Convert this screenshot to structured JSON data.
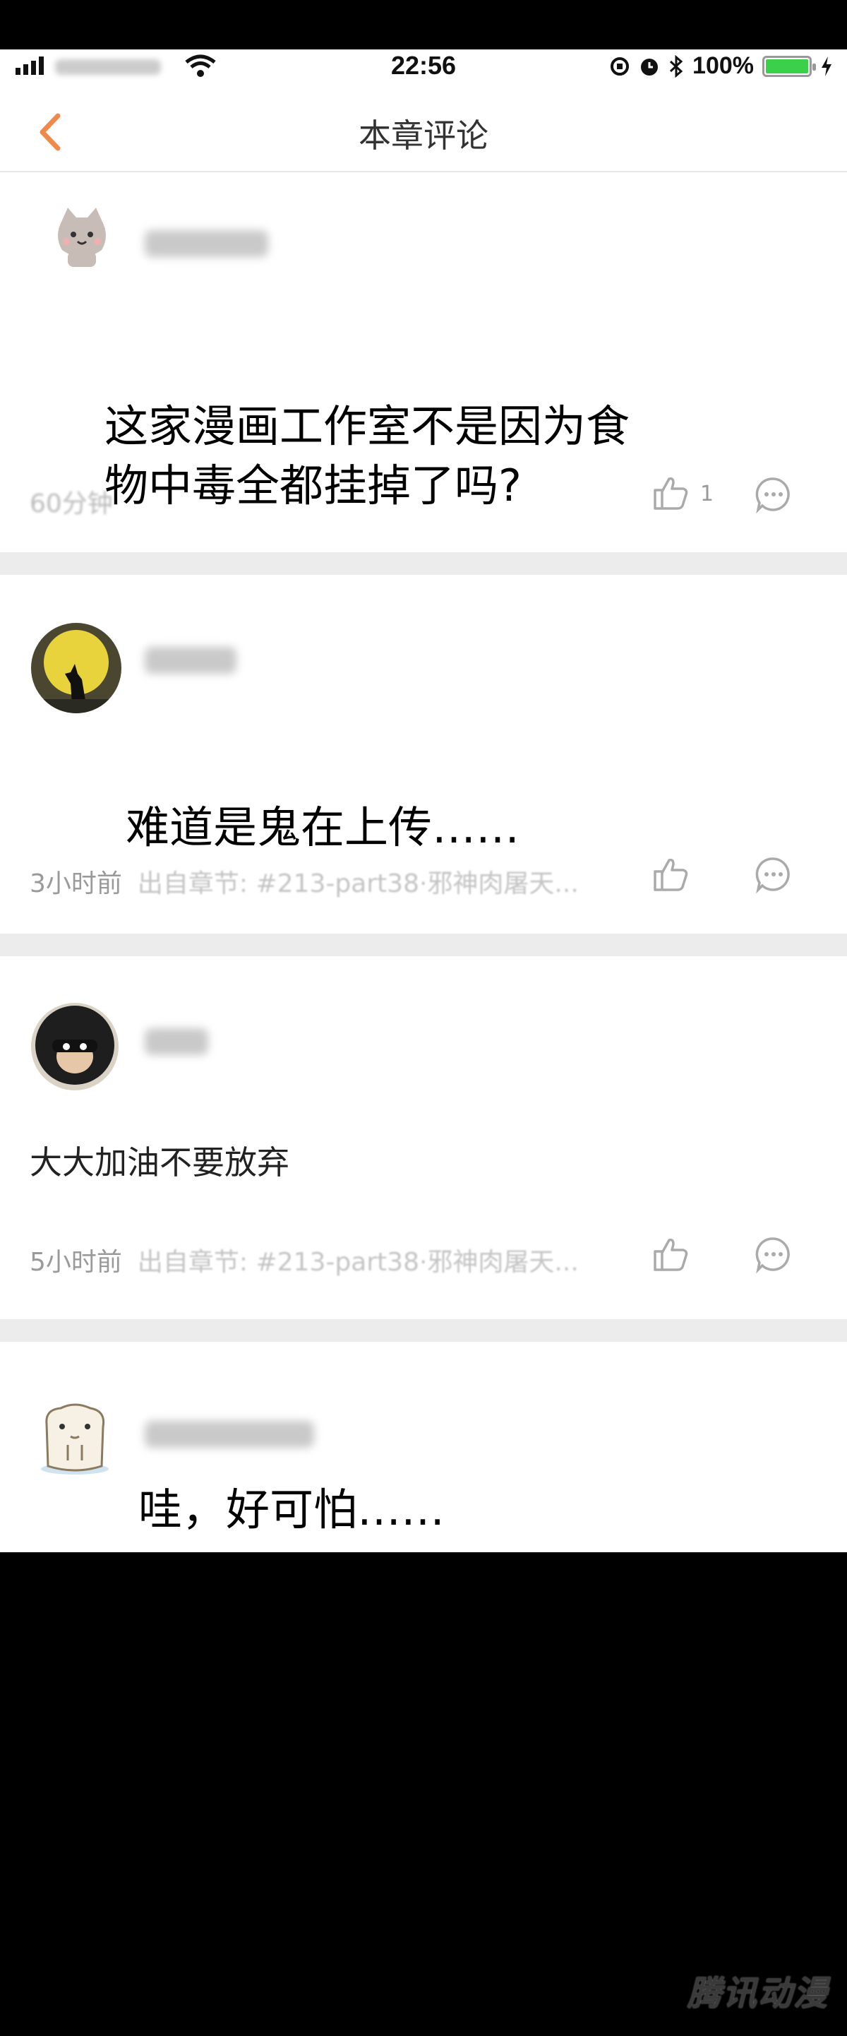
{
  "status_bar": {
    "time": "22:56",
    "battery": "100%"
  },
  "nav": {
    "title": "本章评论"
  },
  "comments": [
    {
      "caption": "这家漫画工作室不是因为食物中毒全都挂掉了吗?",
      "time": "60分钟",
      "likes": "1"
    },
    {
      "caption": "难道是鬼在上传……",
      "time": "3小时前",
      "source": "出自章节: #213-part38·邪神肉屠天..."
    },
    {
      "text": "大大加油不要放弃",
      "time": "5小时前",
      "source": "出自章节: #213-part38·邪神肉屠天..."
    },
    {
      "caption": "哇，好可怕……"
    }
  ],
  "watermark": "腾讯动漫",
  "colors": {
    "accent": "#f08a4b",
    "battery": "#3ad04a",
    "separator": "#ececec"
  }
}
